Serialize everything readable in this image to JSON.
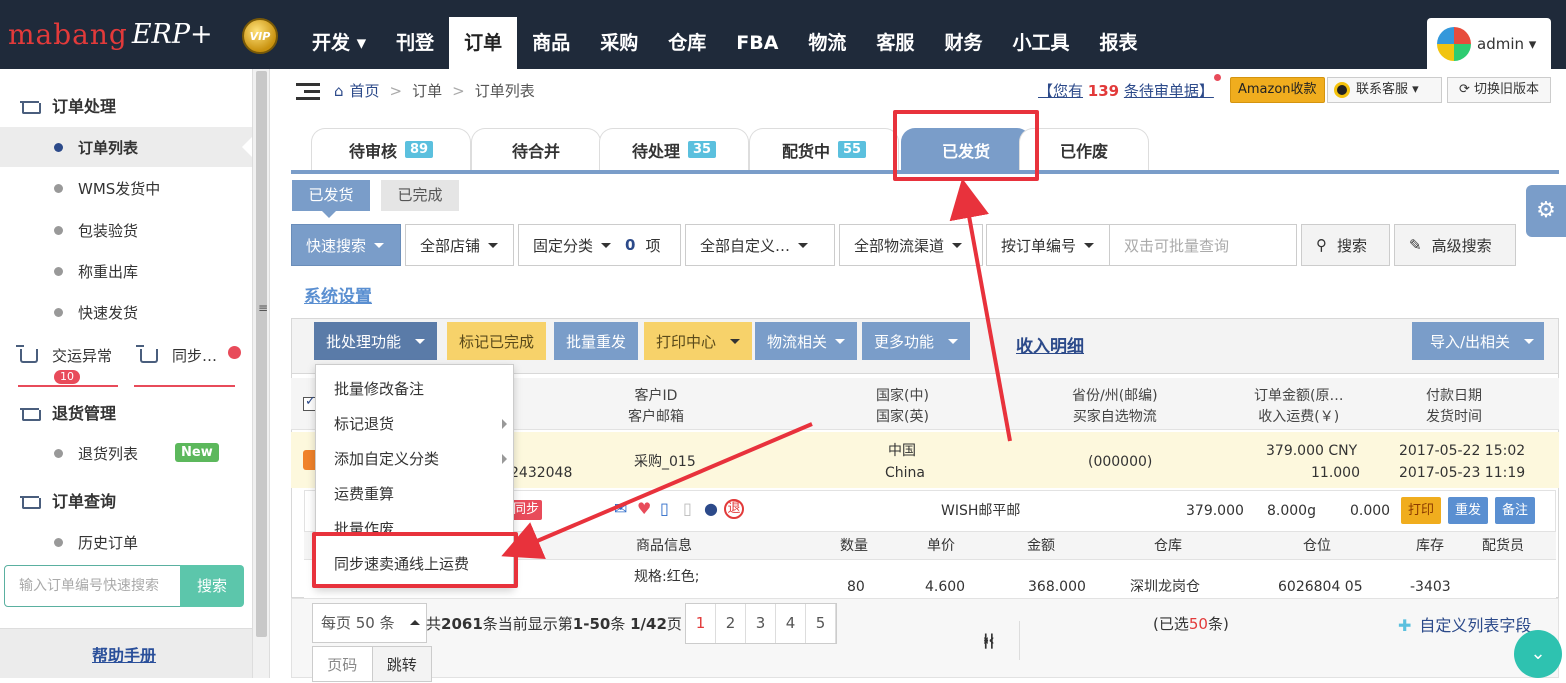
{
  "logo": {
    "brand": "mabang",
    "product": "ERP+",
    "vip": "VIP"
  },
  "nav": [
    "开发 ▾",
    "刊登",
    "订单",
    "商品",
    "采购",
    "仓库",
    "FBA",
    "物流",
    "客服",
    "财务",
    "小工具",
    "报表"
  ],
  "nav_active_index": 2,
  "user": {
    "name": "admin ▾"
  },
  "sidebar": {
    "sec_order": "订单处理",
    "items": [
      "订单列表",
      "WMS发货中",
      "包装验货",
      "称重出库",
      "快速发货"
    ],
    "exception": "交运异常",
    "exception_count": "10",
    "sync": "同步…",
    "sec_return": "退货管理",
    "return_list": "退货列表",
    "new_badge": "New",
    "sec_query": "订单查询",
    "history": "历史订单",
    "search_placeholder": "输入订单编号快速搜索",
    "search_btn": "搜索",
    "help": "帮助手册"
  },
  "breadcrumb": {
    "home": "首页",
    "sep": ">",
    "b1": "订单",
    "b2": "订单列表"
  },
  "header_right": {
    "pend_a": "【您有",
    "pend_count": "139",
    "pend_b": "条待审单据】",
    "amazon": "Amazon收款",
    "support": "联系客服 ▾",
    "old_version": "切换旧版本"
  },
  "tabs": [
    {
      "label": "待审核",
      "count": "89"
    },
    {
      "label": "待合并",
      "count": ""
    },
    {
      "label": "待处理",
      "count": "35"
    },
    {
      "label": "配货中",
      "count": "55"
    },
    {
      "label": "已发货",
      "count": ""
    },
    {
      "label": "已作废",
      "count": ""
    }
  ],
  "subtabs": [
    "已发货",
    "已完成"
  ],
  "filters": {
    "quick": "快速搜索",
    "shop": "全部店铺",
    "category": "固定分类",
    "category_count": "0",
    "category_unit": "项",
    "custom": "全部自定义…",
    "logistics": "全部物流渠道",
    "by_order": "按订单编号",
    "input_placeholder": "双击可批量查询",
    "search": "搜索",
    "advanced": "高级搜索"
  },
  "system_settings": "系统设置",
  "actions": {
    "batch": "批处理功能",
    "mark_done": "标记已完成",
    "resend": "批量重发",
    "print": "打印中心",
    "logistics": "物流相关",
    "more": "更多功能",
    "income": "收入明细",
    "import_export": "导入/出相关"
  },
  "table_head": {
    "customer_a": "客户ID",
    "customer_b": "客户邮箱",
    "country_a": "国家(中)",
    "country_b": "国家(英)",
    "province_a": "省份/州(邮编)",
    "province_b": "买家自选物流",
    "amount_a": "订单金额(原…",
    "amount_b": "收入运费(￥)",
    "date_a": "付款日期",
    "date_b": "发货时间"
  },
  "order": {
    "order_id_tail": "2432048",
    "customer": "采购_015",
    "country_cn": "中国",
    "country_en": "China",
    "zip": "(000000)",
    "amount": "379.000 CNY",
    "shipping": "11.000",
    "paid": "2017-05-22 15:02",
    "shipped": "2017-05-23 11:19"
  },
  "package": {
    "sync_tag": "同步",
    "carrier": "WISH邮平邮",
    "value": "379.000",
    "weight": "8.000g",
    "fee": "0.000",
    "print": "打印",
    "resend": "重发",
    "note": "备注"
  },
  "items_head": [
    "商品信息",
    "数量",
    "单价",
    "金额",
    "仓库",
    "仓位",
    "库存",
    "配货员"
  ],
  "item": {
    "spec": "规格:红色;",
    "qty": "80",
    "price": "4.600",
    "amount": "368.000",
    "warehouse": "深圳龙岗仓",
    "bin": "6026804 05",
    "stock": "-3403"
  },
  "batch_menu": [
    "批量修改备注",
    "标记退货",
    "添加自定义分类",
    "运费重算",
    "批量作废",
    "同步速卖通线上运费"
  ],
  "footer": {
    "per_page": "每页 50 条",
    "total_a": "共",
    "total": "2061",
    "total_b": "条当前显示第",
    "range": "1-50",
    "total_c": "条",
    "pages": "1/42",
    "total_d": "页",
    "pages_list": [
      "1",
      "2",
      "3",
      "4",
      "5"
    ],
    "selected_a": "(已选",
    "selected": "50",
    "selected_b": "条)",
    "custom_fields": "自定义列表字段",
    "page_input": "页码",
    "jump": "跳转"
  },
  "colors": {
    "accent": "#7a9dc9",
    "highlight": "#e8323c",
    "topbar": "#1f2a3a"
  }
}
